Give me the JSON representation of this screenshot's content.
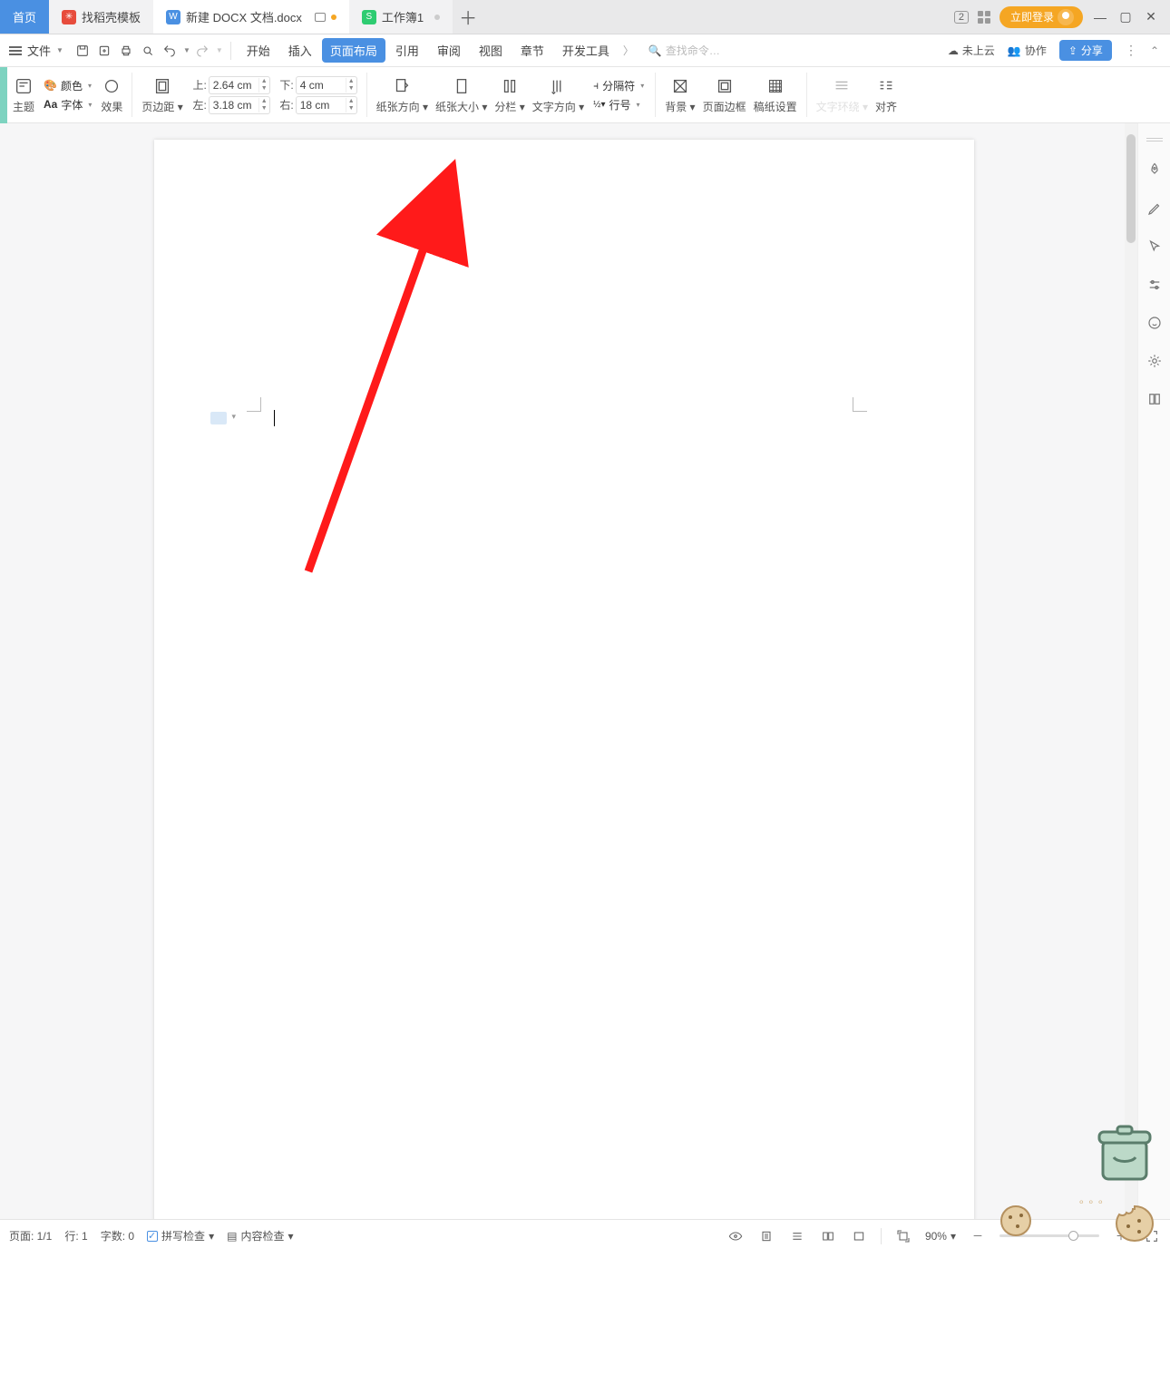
{
  "titlebar": {
    "home": "首页",
    "tab1": "找稻壳模板",
    "tab2": "新建 DOCX 文档.docx",
    "tab3": "工作簿1",
    "badge": "2",
    "login": "立即登录"
  },
  "menubar": {
    "file": "文件",
    "tabs": [
      "开始",
      "插入",
      "页面布局",
      "引用",
      "审阅",
      "视图",
      "章节",
      "开发工具"
    ],
    "active_index": 2,
    "search_placeholder": "查找命令…",
    "cloud": "未上云",
    "coop": "协作",
    "share": "分享"
  },
  "ribbon": {
    "theme": "主题",
    "font": "字体",
    "color": "颜色",
    "effect": "效果",
    "page_margin": "页边距",
    "top_lbl": "上:",
    "top_val": "2.64 cm",
    "left_lbl": "左:",
    "left_val": "3.18 cm",
    "bot_lbl": "下:",
    "bot_val": "4 cm",
    "right_lbl": "右:",
    "right_val": "18 cm",
    "orientation": "纸张方向",
    "size": "纸张大小",
    "columns": "分栏",
    "text_dir": "文字方向",
    "sep": "分隔符",
    "line_no": "行号",
    "bg": "背景",
    "border": "页面边框",
    "writing_paper": "稿纸设置",
    "text_wrap": "文字环绕",
    "align": "对齐"
  },
  "status": {
    "page": "页面: 1/1",
    "line": "行: 1",
    "words": "字数: 0",
    "spell": "拼写检查",
    "content": "内容检查",
    "zoom": "90%"
  }
}
